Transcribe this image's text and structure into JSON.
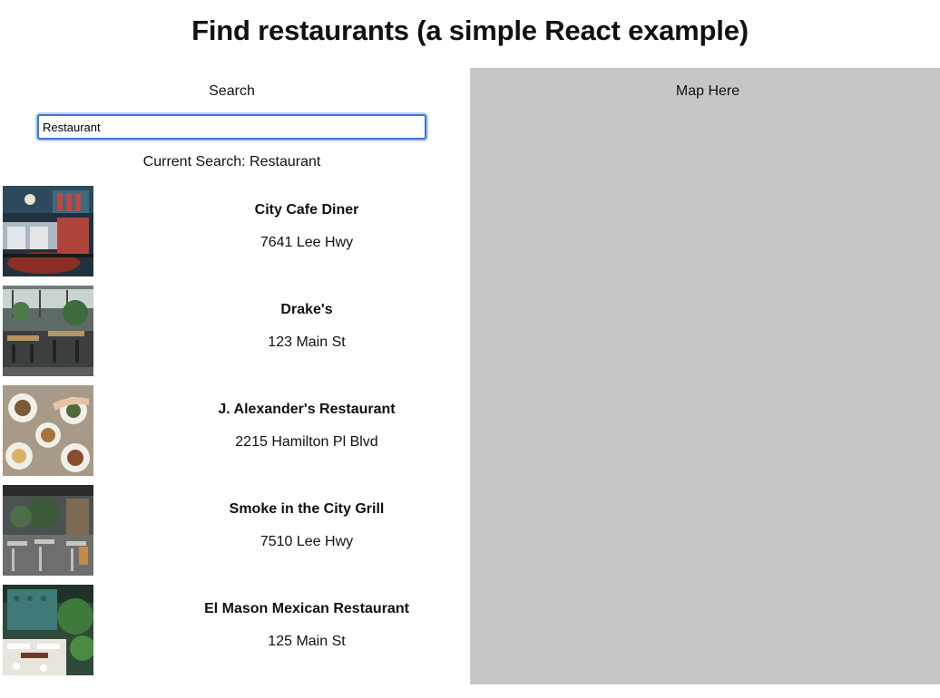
{
  "header": {
    "title": "Find restaurants (a simple React example)"
  },
  "search": {
    "label": "Search",
    "value": "Restaurant",
    "current_prefix": "Current Search: ",
    "current_text": "Current Search: Restaurant"
  },
  "results": [
    {
      "name": "City Cafe Diner",
      "address": "7641 Lee Hwy",
      "thumb_icon": "diner-interior-photo"
    },
    {
      "name": "Drake's",
      "address": "123 Main St",
      "thumb_icon": "patio-dining-photo"
    },
    {
      "name": "J. Alexander's Restaurant",
      "address": "2215 Hamilton Pl Blvd",
      "thumb_icon": "food-plates-photo"
    },
    {
      "name": "Smoke in the City Grill",
      "address": "7510 Lee Hwy",
      "thumb_icon": "cafe-seating-photo"
    },
    {
      "name": "El Mason Mexican Restaurant",
      "address": "125 Main St",
      "thumb_icon": "garden-dining-photo"
    }
  ],
  "map": {
    "label": "Map Here",
    "background": "#c6c6c6"
  },
  "colors": {
    "input_border": "#3b74d9",
    "input_focus_ring": "#b9cff3"
  }
}
